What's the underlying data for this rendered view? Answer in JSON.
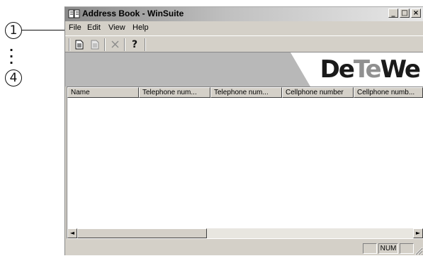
{
  "callouts": {
    "first": "1",
    "last": "4"
  },
  "window": {
    "title": "Address Book - WinSuite"
  },
  "titlebar_buttons": {
    "minimize": "_",
    "maximize": "□",
    "close": "×"
  },
  "menu": {
    "file": "File",
    "edit": "Edit",
    "view": "View",
    "help": "Help"
  },
  "toolbar": {
    "icons": [
      "new-entry-icon",
      "edit-entry-icon",
      "delete-icon",
      "help-icon"
    ],
    "help_glyph": "?"
  },
  "banner": {
    "logo_part1": "De",
    "logo_part2": "Te",
    "logo_part3": "We"
  },
  "list": {
    "columns": [
      "Name",
      "Telephone num...",
      "Telephone num...",
      "Cellphone number",
      "Cellphone numb..."
    ],
    "rows": []
  },
  "scrollbar": {
    "left_arrow": "◄",
    "right_arrow": "►"
  },
  "statusbar": {
    "num": "NUM"
  },
  "colors": {
    "banner": "#b8b8b8",
    "logo_dark": "#1a1a1a",
    "logo_gray": "#909090",
    "chrome": "#d4d0c8"
  }
}
